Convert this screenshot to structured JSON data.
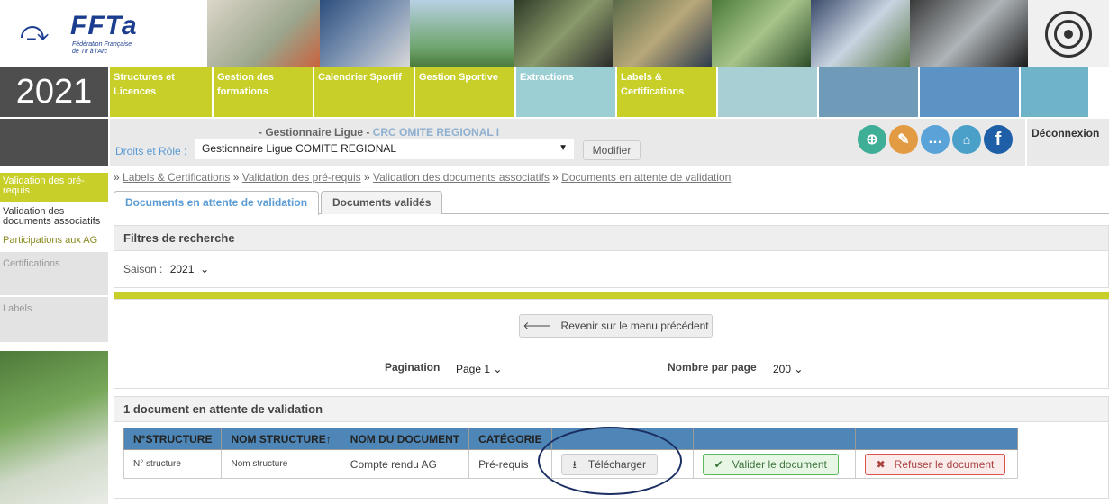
{
  "logo": {
    "name": "FFTa",
    "subtitle_line1": "Fédération Française",
    "subtitle_line2": "de Tir à l'Arc"
  },
  "nav": {
    "year": "2021",
    "items": [
      {
        "label": "Structures et Licences",
        "color": "#c8cf28"
      },
      {
        "label": "Gestion des formations",
        "color": "#c8cf28"
      },
      {
        "label": "Calendrier Sportif",
        "color": "#c8cf28"
      },
      {
        "label": "Gestion Sportive",
        "color": "#c8cf28"
      },
      {
        "label": "Extractions",
        "color": "#9ccfd3"
      },
      {
        "label": "Labels & Certifications",
        "color": "#c8cf28"
      },
      {
        "label": "",
        "color": "#a8cfd3"
      },
      {
        "label": "",
        "color": "#6f9bb8"
      },
      {
        "label": "",
        "color": "#5b93c4"
      },
      {
        "label": "",
        "color": "#6fb3c9"
      }
    ]
  },
  "userbar": {
    "role_line_prefix": "- Gestionnaire Ligue - ",
    "role_line_org": "CRC   OMITE REGIONAL I",
    "droits_label": "Droits et Rôle :",
    "role_select": "Gestionnaire Ligue COMITE REGIONAL",
    "modify_label": "Modifier",
    "logout_label": "Déconnexion",
    "icons": [
      {
        "name": "zoom-icon",
        "color": "#3fae96",
        "glyph": "⊕"
      },
      {
        "name": "edit-icon",
        "color": "#e39b43",
        "glyph": "✎"
      },
      {
        "name": "chat-icon",
        "color": "#5aa3d8",
        "glyph": "…"
      },
      {
        "name": "lock-icon",
        "color": "#4aa0c9",
        "glyph": "🔓"
      },
      {
        "name": "facebook-icon",
        "color": "#1f5fa8",
        "glyph": "f"
      }
    ]
  },
  "sidebar": {
    "items": [
      "Validation des pré-requis",
      "Validation des documents associatifs",
      "Participations aux AG",
      "Certifications",
      "Labels"
    ]
  },
  "breadcrumb": {
    "items": [
      "Labels & Certifications",
      "Validation des pré-requis",
      "Validation des documents associatifs",
      "Documents en attente de validation"
    ]
  },
  "tabs": {
    "pending": "Documents en attente de validation",
    "validated": "Documents validés"
  },
  "filters": {
    "title": "Filtres de recherche",
    "season_label": "Saison :",
    "season_value": "2021"
  },
  "actions": {
    "back_label": "Revenir sur le menu précédent",
    "pagination_label": "Pagination",
    "page_value": "Page 1",
    "per_page_label": "Nombre par page",
    "per_page_value": "200"
  },
  "results": {
    "title": "1 document en attente de validation",
    "columns": [
      "N°STRUCTURE",
      "NOM STRUCTURE↑",
      "NOM DU DOCUMENT",
      "CATÉGORIE"
    ],
    "row": {
      "structure_no": "N° structure",
      "structure_name": "Nom structure",
      "document": "Compte rendu AG",
      "category": "Pré-requis",
      "download_label": "Télécharger",
      "validate_label": "Valider le document",
      "reject_label": "Refuser le document"
    }
  }
}
